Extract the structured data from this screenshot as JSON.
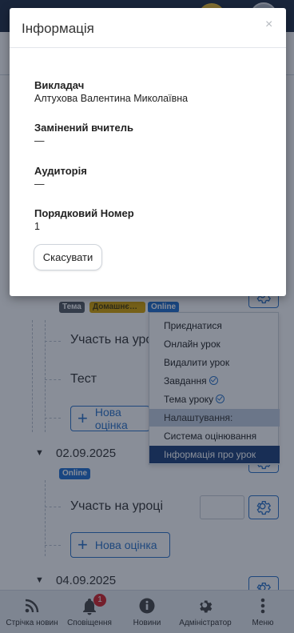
{
  "modal": {
    "title": "Інформація",
    "close": "×",
    "fields": [
      {
        "label": "Викладач",
        "value": "Алтухова Валентина Миколаївна"
      },
      {
        "label": "Замінений вчитель",
        "value": "—"
      },
      {
        "label": "Аудиторія",
        "value": "—"
      },
      {
        "label": "Порядковий Номер",
        "value": "1"
      }
    ],
    "cancel_label": "Скасувати"
  },
  "lesson1": {
    "badges": [
      "Тема",
      "Домашнє…",
      "Online"
    ],
    "rows": [
      "Участь на уроці",
      "Тест"
    ],
    "add_label": "Нова оцінка"
  },
  "lesson2": {
    "date": "02.09.2025",
    "badge": "Online",
    "row": "Участь на уроці",
    "add_label": "Нова оцінка"
  },
  "lesson3": {
    "date": "04.09.2025"
  },
  "dropdown": {
    "items": [
      "Приєднатися",
      "Онлайн урок",
      "Видалити урок",
      "Завдання",
      "Тема уроку"
    ],
    "header": "Налаштування:",
    "settings_items": [
      "Система оцінювання",
      "Інформація про урок"
    ]
  },
  "bottom_nav": [
    {
      "label": "Стрічка новин",
      "icon": "rss-icon"
    },
    {
      "label": "Сповіщення",
      "icon": "bell-icon",
      "badge": "1"
    },
    {
      "label": "Новини",
      "icon": "info-icon"
    },
    {
      "label": "Адміністратор",
      "icon": "gear-icon"
    },
    {
      "label": "Меню",
      "icon": "more-vertical-icon"
    }
  ],
  "colors": {
    "accent": "#2a72c9",
    "header_dark": "#1f2d44",
    "menu_selected": "#1c3f78",
    "badge_red": "#d42027"
  }
}
